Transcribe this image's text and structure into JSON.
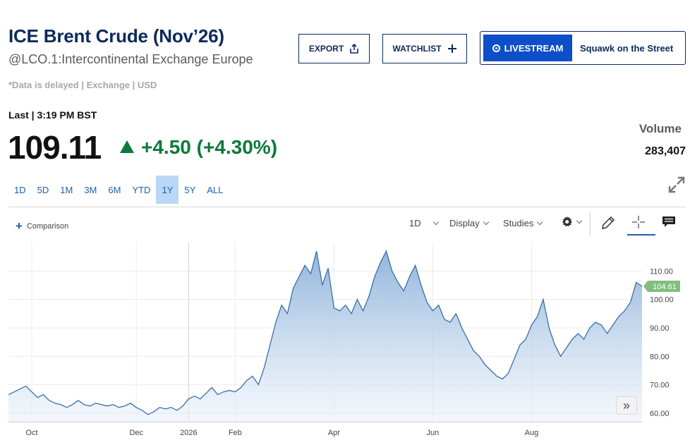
{
  "header": {
    "title": "ICE Brent Crude (Nov’26)",
    "subtitle": "@LCO.1:Intercontinental Exchange Europe",
    "delayed_note": "*Data is delayed | Exchange | USD"
  },
  "actions": {
    "export_label": "EXPORT",
    "watchlist_label": "WATCHLIST",
    "livestream_label": "LIVESTREAM",
    "livestream_show": "Squawk on the Street"
  },
  "quote": {
    "last_label": "Last | 3:19 PM BST",
    "price": "109.11",
    "change": "+4.50 (+4.30%)",
    "volume_label": "Volume",
    "volume_value": "283,407"
  },
  "ranges": [
    "1D",
    "5D",
    "1M",
    "3M",
    "6M",
    "YTD",
    "1Y",
    "5Y",
    "ALL"
  ],
  "active_range": "1Y",
  "toolbar": {
    "comparison_label": "Comparison",
    "interval_label": "1D",
    "display_label": "Display",
    "studies_label": "Studies"
  },
  "colors": {
    "brand_navy": "#0b2a5b",
    "accent_blue": "#0d4ec9",
    "positive_green": "#0b7a3b",
    "range_active_bg": "#b9d7f7",
    "line": "#3a6fa6",
    "last_price_tag": "#7fbf7f"
  },
  "chart_data": {
    "type": "area",
    "x_tick_labels": [
      "Oct",
      "Dec",
      "2026",
      "Feb",
      "Apr",
      "Jun",
      "Aug"
    ],
    "y_tick_labels": [
      "60.00",
      "70.00",
      "80.00",
      "90.00",
      "100.00",
      "110.00"
    ],
    "ylim": [
      57,
      120
    ],
    "grid": true,
    "last_price_tag": "104.61",
    "series": [
      {
        "values": [
          66.5,
          67.5,
          68.5,
          69.5,
          67.5,
          65.5,
          66.5,
          64.5,
          63.5,
          63,
          62,
          63,
          64.5,
          63,
          62.5,
          63.5,
          63,
          62.5,
          63,
          62,
          62.5,
          63.5,
          62,
          61,
          59.5,
          60.5,
          62,
          61.5,
          62,
          61,
          62.5,
          65,
          66,
          65,
          67,
          69,
          66.5,
          67.5,
          68,
          67.5,
          69,
          71.5,
          73,
          70,
          76,
          84,
          92,
          98,
          95,
          104,
          108,
          112,
          109,
          117,
          105,
          111,
          97,
          96,
          98,
          95,
          100,
          96,
          101,
          108,
          113,
          117,
          110,
          106,
          103,
          108,
          112,
          105,
          99,
          96,
          98,
          93,
          92,
          95,
          90,
          86,
          82,
          80,
          77,
          75,
          73,
          72,
          74,
          79,
          84,
          86,
          91,
          94,
          100,
          90,
          84,
          80,
          83,
          86,
          88,
          86,
          90,
          92,
          91,
          88,
          91,
          94,
          96,
          99,
          106,
          104.61
        ]
      }
    ]
  }
}
